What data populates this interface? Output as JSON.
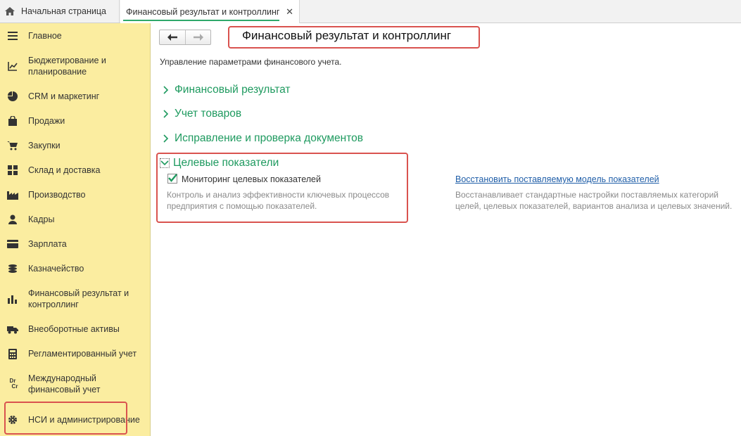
{
  "tabs": {
    "home": "Начальная страница",
    "active": "Финансовый результат и контроллинг",
    "close": "✕"
  },
  "sidebar": {
    "items": [
      {
        "label": "Главное",
        "icon": "menu-icon"
      },
      {
        "label": "Бюджетирование и планирование",
        "icon": "budget-icon"
      },
      {
        "label": "CRM и маркетинг",
        "icon": "pie-chart-icon"
      },
      {
        "label": "Продажи",
        "icon": "shopping-bag-icon"
      },
      {
        "label": "Закупки",
        "icon": "cart-icon"
      },
      {
        "label": "Склад и доставка",
        "icon": "warehouse-icon"
      },
      {
        "label": "Производство",
        "icon": "factory-icon"
      },
      {
        "label": "Кадры",
        "icon": "person-icon"
      },
      {
        "label": "Зарплата",
        "icon": "card-icon"
      },
      {
        "label": "Казначейство",
        "icon": "coins-icon"
      },
      {
        "label": "Финансовый результат и контроллинг",
        "icon": "bar-chart-icon"
      },
      {
        "label": "Внеоборотные активы",
        "icon": "truck-icon"
      },
      {
        "label": "Регламентированный учет",
        "icon": "calculator-icon"
      },
      {
        "label": "Международный финансовый учет",
        "icon": "dr-cr-icon"
      },
      {
        "label": "НСИ и администрирование",
        "icon": "gear-icon"
      }
    ],
    "drcr_glyph_top": "Dr",
    "drcr_glyph_bottom": "Cr"
  },
  "main": {
    "title": "Финансовый результат и контроллинг",
    "description": "Управление параметрами финансового учета.",
    "groups": [
      {
        "label": "Финансовый результат",
        "expanded": false
      },
      {
        "label": "Учет товаров",
        "expanded": false
      },
      {
        "label": "Исправление и проверка документов",
        "expanded": false
      },
      {
        "label": "Целевые показатели",
        "expanded": true
      }
    ],
    "monitoring": {
      "label": "Мониторинг целевых показателей",
      "checked": true,
      "hint": "Контроль и анализ эффективности ключевых процессов предприятия с помощью показателей."
    },
    "restore": {
      "link": "Восстановить поставляемую модель показателей",
      "hint": "Восстанавливает стандартные настройки поставляемых категорий целей, целевых показателей, вариантов анализа и целевых значений."
    }
  },
  "colors": {
    "sidebar_bg": "#fbeda0",
    "group_green": "#1e9a5f",
    "highlight_red": "#d9534f",
    "link_blue": "#1f5ea8",
    "tab_underline": "#2fa86b"
  }
}
